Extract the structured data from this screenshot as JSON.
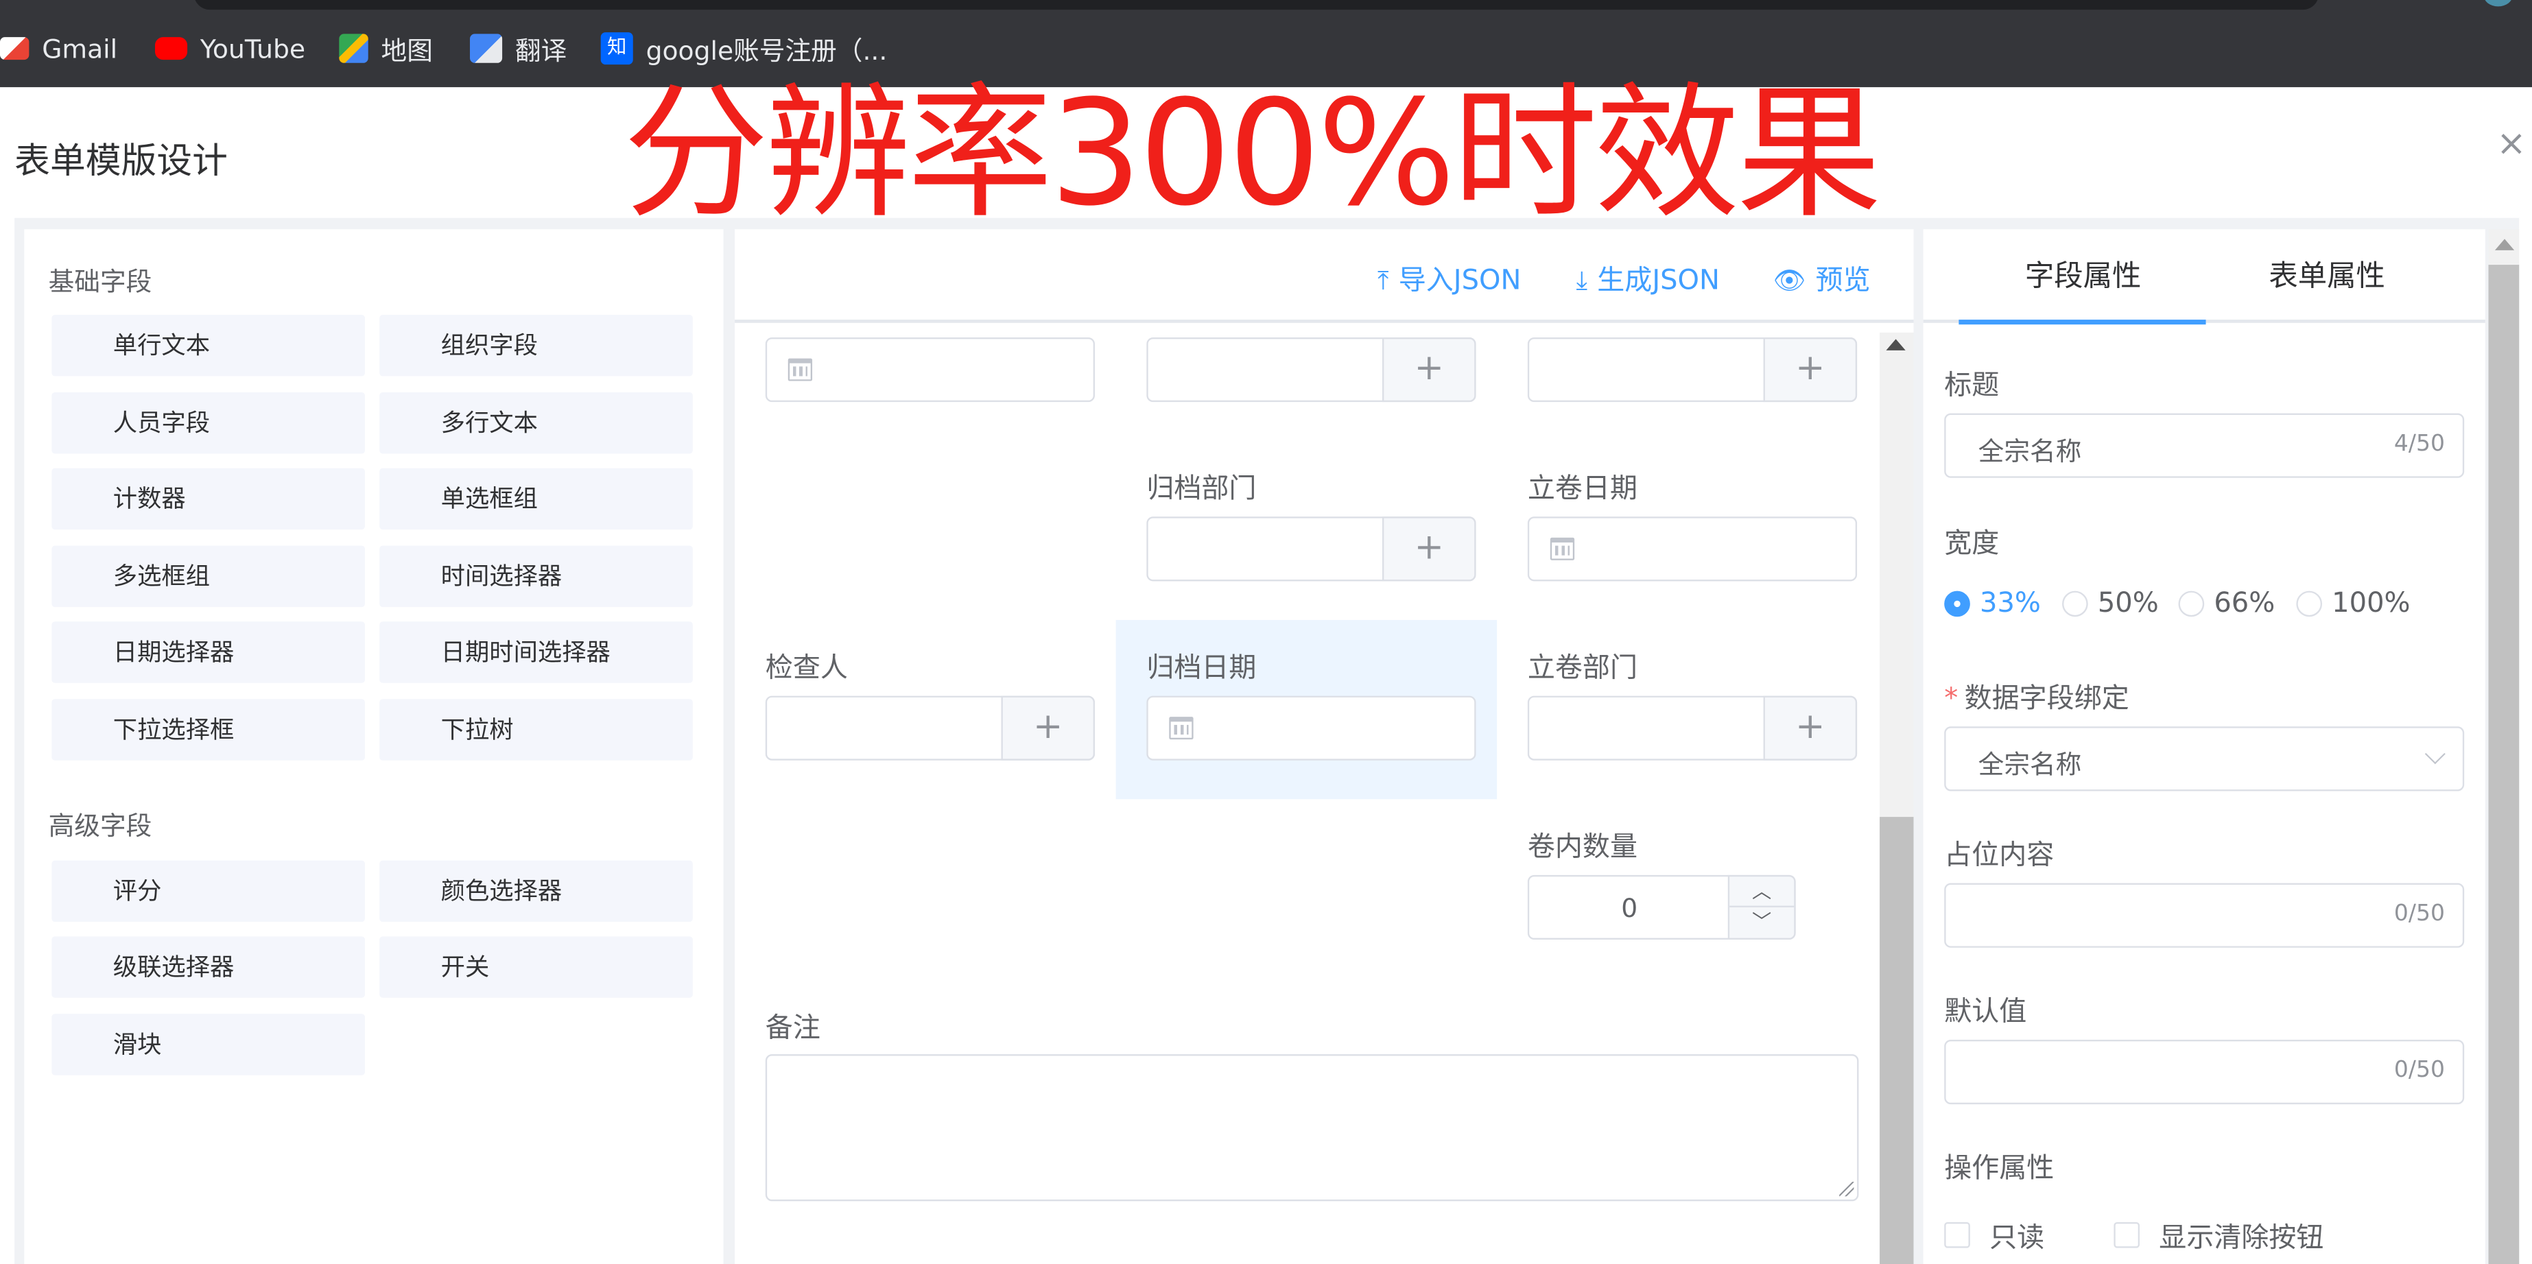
{
  "bookmarks": [
    {
      "label": "Gmail",
      "icon": "gmail-icon",
      "color": "#ea4335"
    },
    {
      "label": "YouTube",
      "icon": "youtube-icon",
      "color": "#ff0000"
    },
    {
      "label": "地图",
      "icon": "maps-icon",
      "color": "#34a853"
    },
    {
      "label": "翻译",
      "icon": "translate-icon",
      "color": "#4285f4"
    },
    {
      "label": "google账号注册（...",
      "icon": "zhihu-icon",
      "color": "#0066ff"
    }
  ],
  "dialog": {
    "title": "表单模版设计",
    "close": "×"
  },
  "watermark": "分辨率300%时效果",
  "left_panel": {
    "basic_title": "基础字段",
    "basic_items": [
      "单行文本",
      "组织字段",
      "人员字段",
      "多行文本",
      "计数器",
      "单选框组",
      "多选框组",
      "时间选择器",
      "日期选择器",
      "日期时间选择器",
      "下拉选择框",
      "下拉树"
    ],
    "advanced_title": "高级字段",
    "advanced_items": [
      "评分",
      "颜色选择器",
      "级联选择器",
      "开关",
      "滑块"
    ]
  },
  "toolbar": {
    "import": "导入JSON",
    "generate": "生成JSON",
    "preview": "预览"
  },
  "form": {
    "archive_dept": "归档部门",
    "file_date": "立卷日期",
    "inspector": "检查人",
    "archive_date": "归档日期",
    "file_dept": "立卷部门",
    "volume_count": "卷内数量",
    "volume_count_value": "0",
    "remark": "备注",
    "plus": "+"
  },
  "right_panel": {
    "tabs": [
      "字段属性",
      "表单属性"
    ],
    "active_tab": "字段属性",
    "title_label": "标题",
    "title_value": "全宗名称",
    "title_count": "4/50",
    "width_label": "宽度",
    "width_options": [
      "33%",
      "50%",
      "66%",
      "100%"
    ],
    "width_selected": "33%",
    "binding_label": "数据字段绑定",
    "binding_required": "*",
    "binding_value": "全宗名称",
    "placeholder_label": "占位内容",
    "placeholder_count": "0/50",
    "default_label": "默认值",
    "default_count": "0/50",
    "ops_label": "操作属性",
    "ops": [
      "只读",
      "显示清除按钮"
    ]
  },
  "colors": {
    "accent": "#409eff",
    "watermark": "#f0201a",
    "selected_bg": "#ecf5ff"
  }
}
